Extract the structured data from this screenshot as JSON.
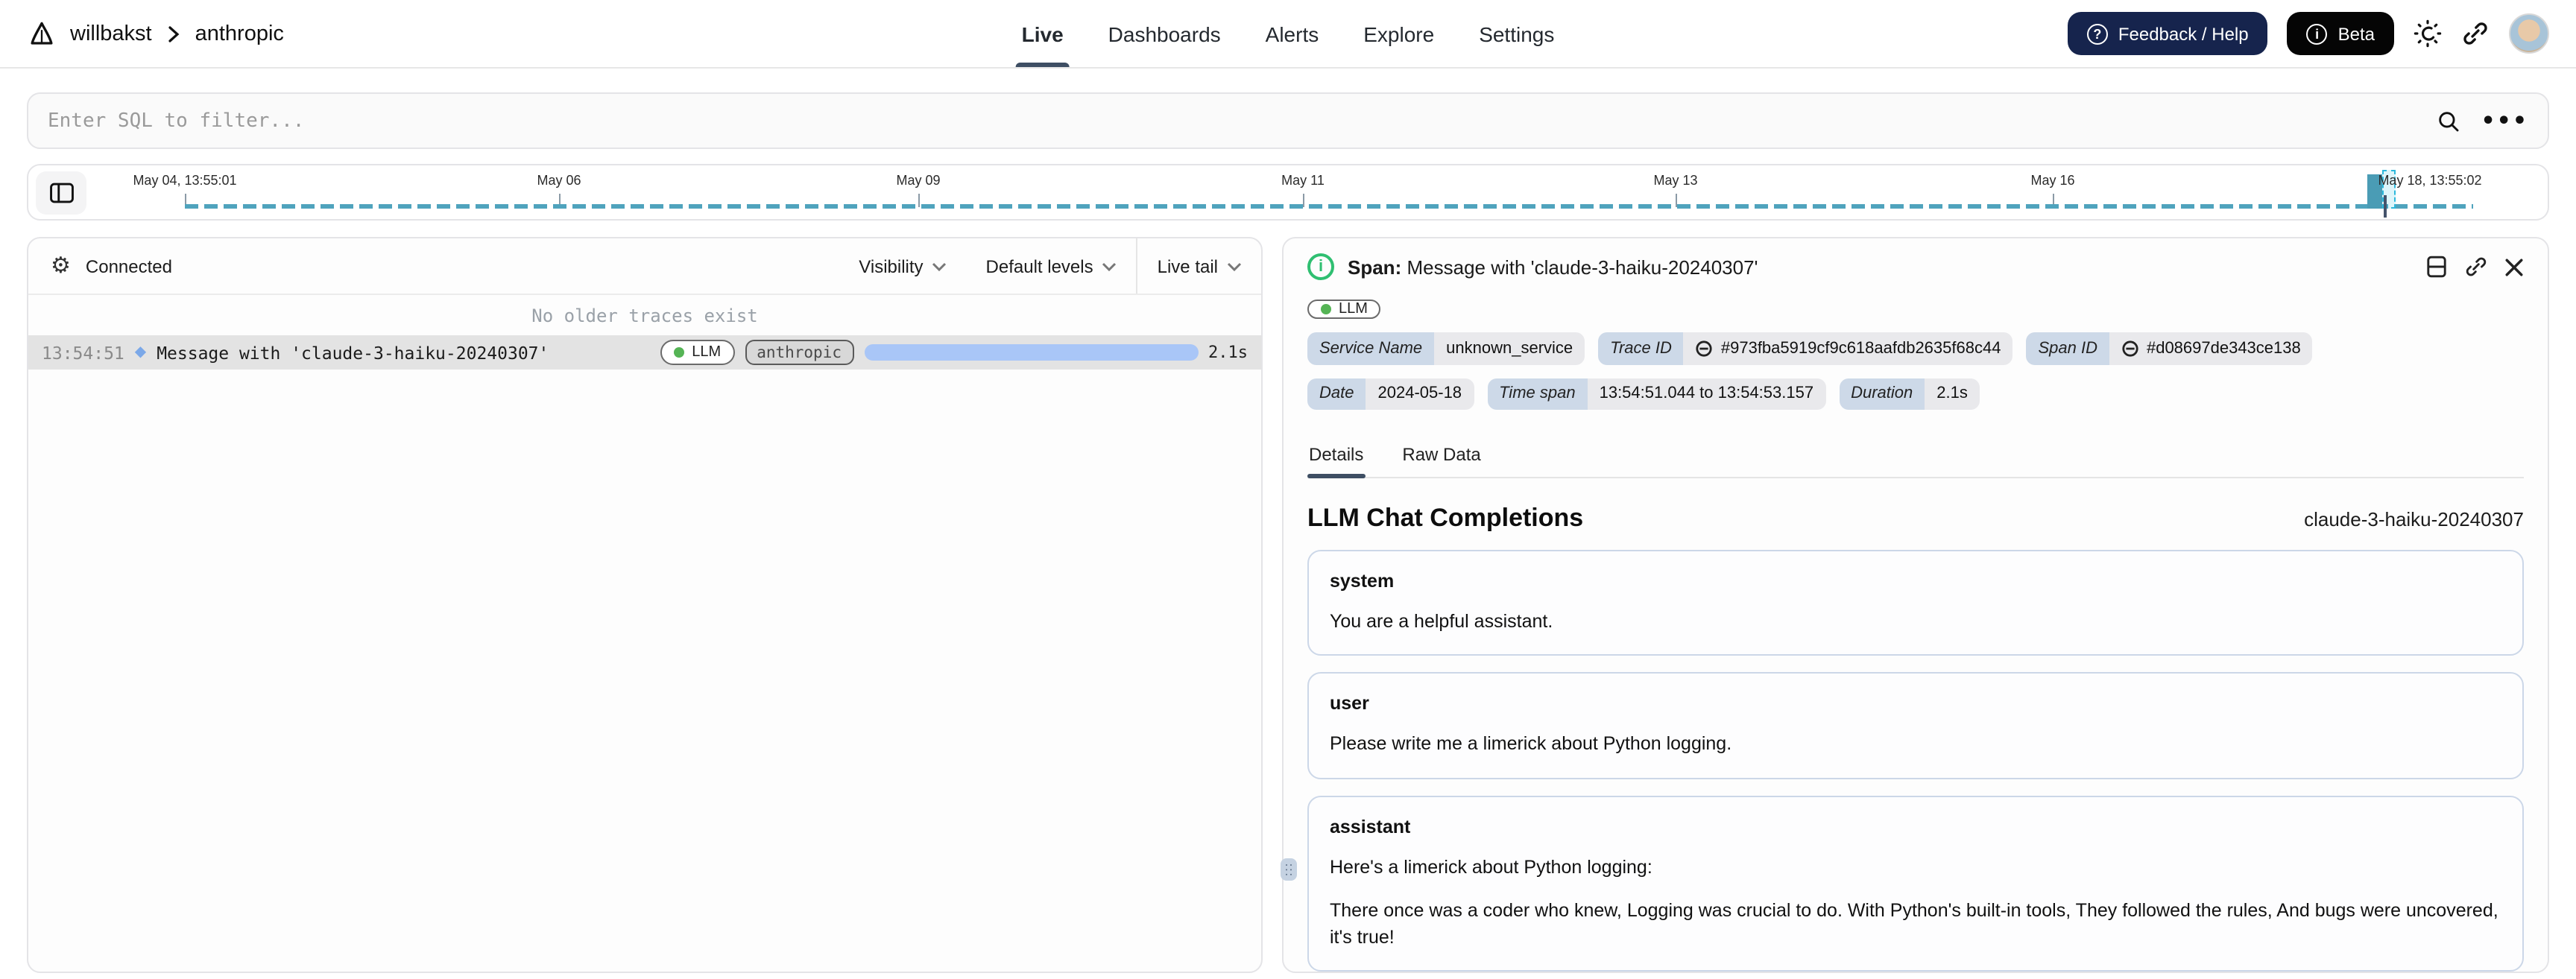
{
  "header": {
    "breadcrumb": {
      "org": "willbakst",
      "project": "anthropic"
    },
    "nav_tabs": [
      {
        "label": "Live",
        "active": true
      },
      {
        "label": "Dashboards",
        "active": false
      },
      {
        "label": "Alerts",
        "active": false
      },
      {
        "label": "Explore",
        "active": false
      },
      {
        "label": "Settings",
        "active": false
      }
    ],
    "feedback_button_label": "Feedback / Help",
    "beta_button_label": "Beta"
  },
  "filter_bar": {
    "placeholder": "Enter SQL to filter..."
  },
  "timeline": {
    "ticks": [
      {
        "label": "May 04, 13:55:01"
      },
      {
        "label": "May 06"
      },
      {
        "label": "May 09"
      },
      {
        "label": "May 11"
      },
      {
        "label": "May 13"
      },
      {
        "label": "May 16"
      },
      {
        "label": "May 18, 13:55:02"
      }
    ]
  },
  "trace_panel": {
    "status": "Connected",
    "controls": {
      "visibility": "Visibility",
      "default_levels": "Default levels",
      "live_tail": "Live tail"
    },
    "empty_message": "No older traces exist",
    "row": {
      "time": "13:54:51",
      "title": "Message with 'claude-3-haiku-20240307'",
      "badge_llm": "LLM",
      "badge_provider": "anthropic",
      "duration": "2.1s"
    }
  },
  "span_panel": {
    "header_label": "Span:",
    "header_title": "Message with 'claude-3-haiku-20240307'",
    "badge_llm": "LLM",
    "meta": [
      {
        "label": "Service Name",
        "value": "unknown_service"
      },
      {
        "label": "Trace ID",
        "value": "#973fba5919cf9c618aafdb2635f68c44"
      },
      {
        "label": "Span ID",
        "value": "#d08697de343ce138"
      },
      {
        "label": "Date",
        "value": "2024-05-18"
      },
      {
        "label": "Time span",
        "value": "13:54:51.044 to 13:54:53.157"
      },
      {
        "label": "Duration",
        "value": "2.1s"
      }
    ],
    "tabs": [
      {
        "label": "Details",
        "active": true
      },
      {
        "label": "Raw Data",
        "active": false
      }
    ],
    "section_title": "LLM Chat Completions",
    "model": "claude-3-haiku-20240307",
    "messages": [
      {
        "role": "system",
        "content": "You are a helpful assistant."
      },
      {
        "role": "user",
        "content": "Please write me a limerick about Python logging."
      },
      {
        "role": "assistant",
        "content": "Here's a limerick about Python logging:",
        "content2": "There once was a coder who knew, Logging was crucial to do. With Python's built-in tools, They followed the rules, And bugs were uncovered, it's true!"
      }
    ]
  },
  "colors": {
    "accent_underline": "#3e4e63",
    "timeline_teal": "#4fa3bd",
    "timeline_bar": "#4a9cb5",
    "selection_cyan": "#2cb8dc",
    "duration_bar_blue": "#a9c6f7",
    "navy_button": "#16244d",
    "beta_button": "#050505",
    "selected_row_bg": "#e3e3e3",
    "llm_dot_green": "#55b455",
    "chip_label_bg": "#cdd9e8",
    "chip_value_bg": "#e9e9ec",
    "card_border": "#ccd7e8",
    "info_icon_green": "#2fbf71"
  }
}
